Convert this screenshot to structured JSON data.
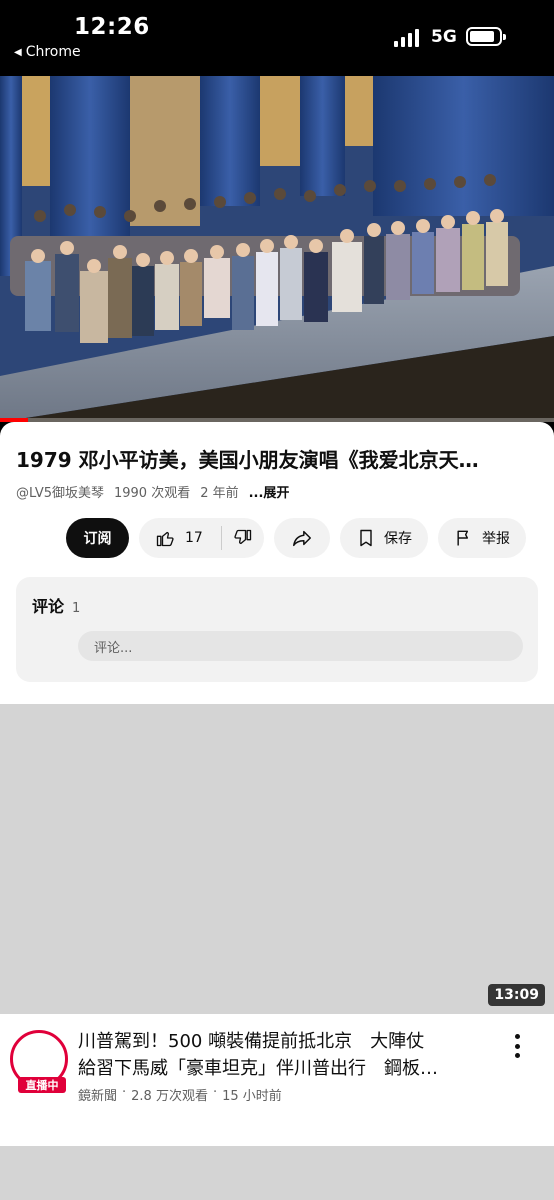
{
  "status_bar": {
    "time": "12:26",
    "back_app": "Chrome",
    "network": "5G"
  },
  "player": {
    "progress_fraction": 0.05,
    "progress_color": "#ff0000"
  },
  "video": {
    "title": "1979 邓小平访美，美国小朋友演唱《我爱北京天…",
    "channel": "@LV5御坂美琴",
    "views": "1990 次观看",
    "age": "2 年前",
    "more": "...展开"
  },
  "actions": {
    "subscribe": "订阅",
    "like_count": "17",
    "save": "保存",
    "report": "举报"
  },
  "comments": {
    "label": "评论",
    "count": "1",
    "placeholder": "评论..."
  },
  "next_video": {
    "duration": "13:09",
    "title_line1": "川普駕到！500 噸裝備提前抵北京　大陣仗",
    "title_line2": "給習下馬威「豪車坦克」伴川普出行　鋼板…",
    "live_badge": "直播中",
    "channel": "鏡新聞",
    "views": "2.8 万次观看",
    "age": "15 小时前",
    "separator": "·"
  },
  "colors": {
    "accent_red": "#ff0000",
    "live_red": "#e0003a",
    "pill_bg": "#f2f2f2",
    "placeholder_bg": "#d4d4d4"
  }
}
